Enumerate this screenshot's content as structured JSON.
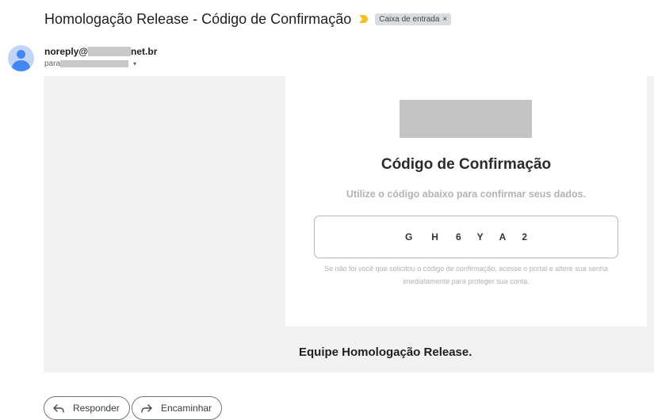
{
  "email": {
    "subject": "Homologação Release - Código de Confirmação",
    "label": "Caixa de entrada",
    "label_close": "×",
    "sender_prefix": "noreply@",
    "sender_suffix": "net.br",
    "recipient_prefix": "para",
    "caret": "▾"
  },
  "body": {
    "title": "Código de Confirmação",
    "subtitle": "Utilize o código abaixo para confirmar seus dados.",
    "code": [
      "G",
      "H",
      "6",
      "Y",
      "A",
      "2"
    ],
    "disclaimer": "Se não foi você que solicitou o código de confirmação, acesse o portal e altere sua senha imediatamente para proteger sua conta.",
    "signature": "Equipe Homologação Release."
  },
  "actions": {
    "reply": "Responder",
    "forward": "Encaminhar"
  },
  "colors": {
    "importance": "#f6c026",
    "avatar": "#4285f4"
  }
}
